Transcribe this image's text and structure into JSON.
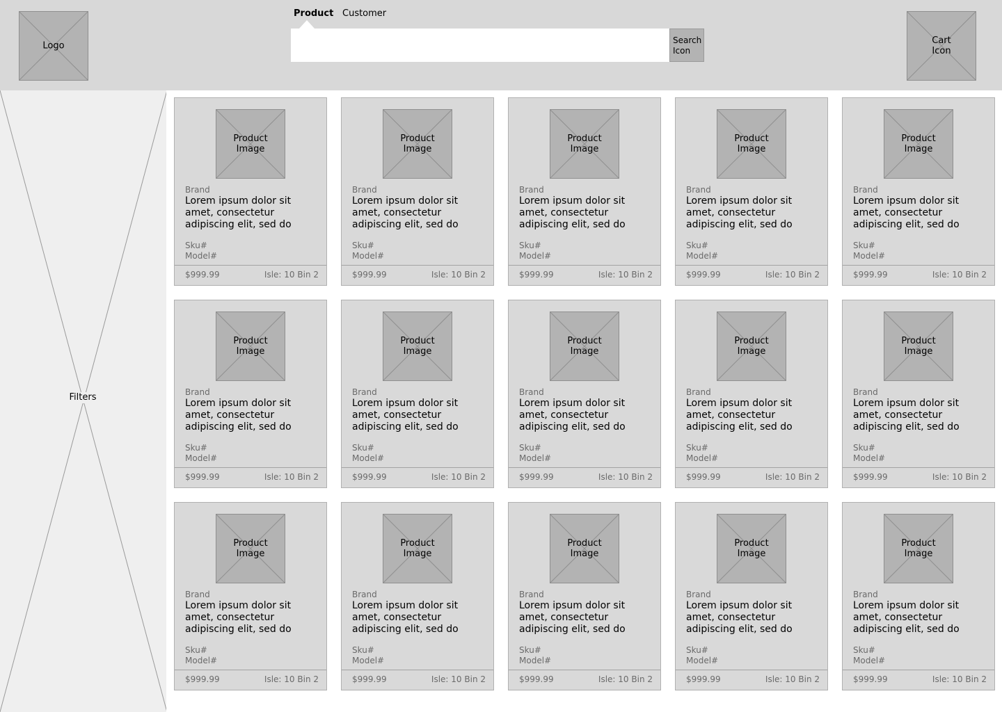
{
  "header": {
    "logo_label": "Logo",
    "cart_label": "Cart Icon",
    "search": {
      "tabs": [
        {
          "label": "Product",
          "active": true
        },
        {
          "label": "Customer",
          "active": false
        }
      ],
      "input_value": "",
      "input_placeholder": "",
      "button_label": "Search Icon"
    }
  },
  "sidebar": {
    "label": "Filters"
  },
  "products": [
    {
      "image_label": "Product Image",
      "brand": "Brand",
      "description": "Lorem ipsum dolor sit amet, consectetur adipiscing elit, sed do",
      "sku": "Sku#",
      "model": "Model#",
      "price": "$999.99",
      "location": "Isle: 10 Bin 2"
    },
    {
      "image_label": "Product Image",
      "brand": "Brand",
      "description": "Lorem ipsum dolor sit amet, consectetur adipiscing elit, sed do",
      "sku": "Sku#",
      "model": "Model#",
      "price": "$999.99",
      "location": "Isle: 10 Bin 2"
    },
    {
      "image_label": "Product Image",
      "brand": "Brand",
      "description": "Lorem ipsum dolor sit amet, consectetur adipiscing elit, sed do",
      "sku": "Sku#",
      "model": "Model#",
      "price": "$999.99",
      "location": "Isle: 10 Bin 2"
    },
    {
      "image_label": "Product Image",
      "brand": "Brand",
      "description": "Lorem ipsum dolor sit amet, consectetur adipiscing elit, sed do",
      "sku": "Sku#",
      "model": "Model#",
      "price": "$999.99",
      "location": "Isle: 10 Bin 2"
    },
    {
      "image_label": "Product Image",
      "brand": "Brand",
      "description": "Lorem ipsum dolor sit amet, consectetur adipiscing elit, sed do",
      "sku": "Sku#",
      "model": "Model#",
      "price": "$999.99",
      "location": "Isle: 10 Bin 2"
    },
    {
      "image_label": "Product Image",
      "brand": "Brand",
      "description": "Lorem ipsum dolor sit amet, consectetur adipiscing elit, sed do",
      "sku": "Sku#",
      "model": "Model#",
      "price": "$999.99",
      "location": "Isle: 10 Bin 2"
    },
    {
      "image_label": "Product Image",
      "brand": "Brand",
      "description": "Lorem ipsum dolor sit amet, consectetur adipiscing elit, sed do",
      "sku": "Sku#",
      "model": "Model#",
      "price": "$999.99",
      "location": "Isle: 10 Bin 2"
    },
    {
      "image_label": "Product Image",
      "brand": "Brand",
      "description": "Lorem ipsum dolor sit amet, consectetur adipiscing elit, sed do",
      "sku": "Sku#",
      "model": "Model#",
      "price": "$999.99",
      "location": "Isle: 10 Bin 2"
    },
    {
      "image_label": "Product Image",
      "brand": "Brand",
      "description": "Lorem ipsum dolor sit amet, consectetur adipiscing elit, sed do",
      "sku": "Sku#",
      "model": "Model#",
      "price": "$999.99",
      "location": "Isle: 10 Bin 2"
    },
    {
      "image_label": "Product Image",
      "brand": "Brand",
      "description": "Lorem ipsum dolor sit amet, consectetur adipiscing elit, sed do",
      "sku": "Sku#",
      "model": "Model#",
      "price": "$999.99",
      "location": "Isle: 10 Bin 2"
    },
    {
      "image_label": "Product Image",
      "brand": "Brand",
      "description": "Lorem ipsum dolor sit amet, consectetur adipiscing elit, sed do",
      "sku": "Sku#",
      "model": "Model#",
      "price": "$999.99",
      "location": "Isle: 10 Bin 2"
    },
    {
      "image_label": "Product Image",
      "brand": "Brand",
      "description": "Lorem ipsum dolor sit amet, consectetur adipiscing elit, sed do",
      "sku": "Sku#",
      "model": "Model#",
      "price": "$999.99",
      "location": "Isle: 10 Bin 2"
    },
    {
      "image_label": "Product Image",
      "brand": "Brand",
      "description": "Lorem ipsum dolor sit amet, consectetur adipiscing elit, sed do",
      "sku": "Sku#",
      "model": "Model#",
      "price": "$999.99",
      "location": "Isle: 10 Bin 2"
    },
    {
      "image_label": "Product Image",
      "brand": "Brand",
      "description": "Lorem ipsum dolor sit amet, consectetur adipiscing elit, sed do",
      "sku": "Sku#",
      "model": "Model#",
      "price": "$999.99",
      "location": "Isle: 10 Bin 2"
    },
    {
      "image_label": "Product Image",
      "brand": "Brand",
      "description": "Lorem ipsum dolor sit amet, consectetur adipiscing elit, sed do",
      "sku": "Sku#",
      "model": "Model#",
      "price": "$999.99",
      "location": "Isle: 10 Bin 2"
    }
  ],
  "colors": {
    "header_bg": "#d8d8d8",
    "sidebar_bg": "#efefef",
    "card_bg": "#d9d9d9",
    "placeholder_bg": "#b3b3b3"
  }
}
